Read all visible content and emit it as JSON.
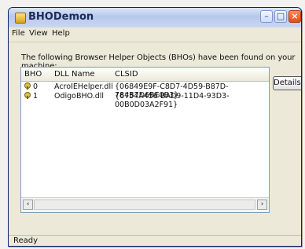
{
  "window": {
    "title": "BHODemon"
  },
  "menu": {
    "items": [
      {
        "label": "File"
      },
      {
        "label": "View"
      },
      {
        "label": "Help"
      }
    ]
  },
  "main": {
    "description": "The following Browser Helper Objects (BHOs) have been found on your machine:",
    "details_button": "Details..."
  },
  "table": {
    "headers": [
      "BHO",
      "DLL Name",
      "CLSID"
    ],
    "rows": [
      {
        "bho": "0",
        "dll": "AcroIEHelper.dll",
        "clsid": "{06849E9F-C8D7-4D59-B87D-784B7D6BE0B3}"
      },
      {
        "bho": "1",
        "dll": "OdigoBHO.dll",
        "clsid": "{6754A456-BAD9-11D4-93D3-00B0D03A2F91}"
      }
    ]
  },
  "status": {
    "text": "Ready"
  }
}
